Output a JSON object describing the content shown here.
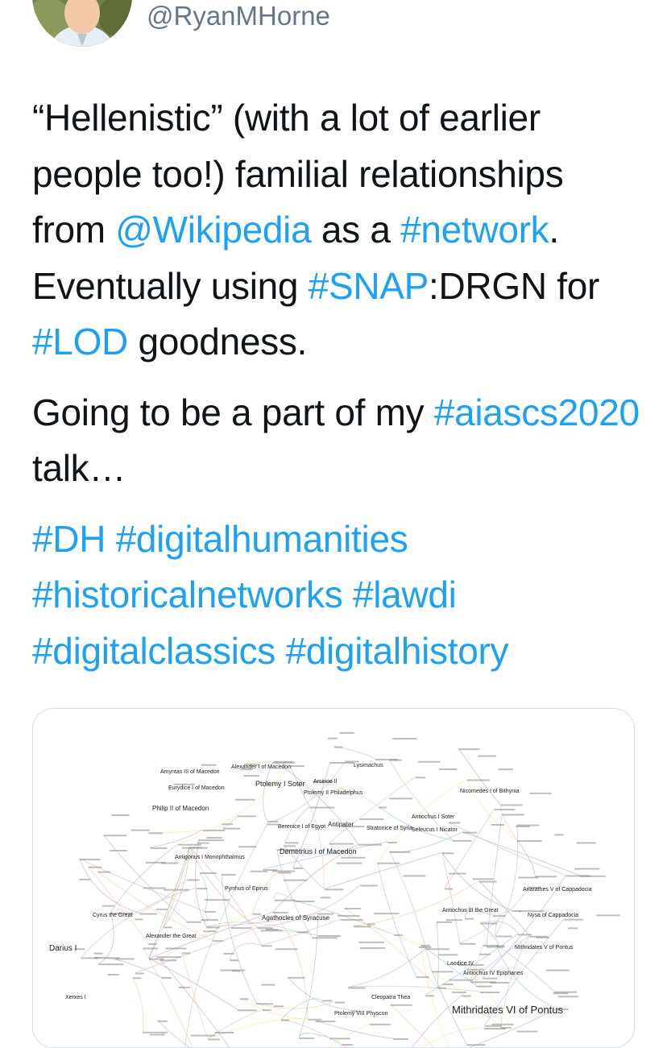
{
  "header": {
    "handle": "@RyanMHorne"
  },
  "tweet": {
    "paragraph1": [
      {
        "text": "“Hellenistic” (with a lot of earlier people too!) familial relationships from ",
        "link": false
      },
      {
        "text": "@Wikipedia",
        "link": true
      },
      {
        "text": " as a ",
        "link": false
      },
      {
        "text": "#network",
        "link": true
      },
      {
        "text": ". Eventually using ",
        "link": false
      },
      {
        "text": "#SNAP",
        "link": true
      },
      {
        "text": ":DRGN for ",
        "link": false
      },
      {
        "text": "#LOD",
        "link": true
      },
      {
        "text": " goodness.",
        "link": false
      }
    ],
    "paragraph2": [
      {
        "text": "Going to be a part of my ",
        "link": false
      },
      {
        "text": "#aiascs2020",
        "link": true
      },
      {
        "text": " talk…",
        "link": false
      }
    ],
    "hashtags": [
      "#DH",
      "#digitalhumanities",
      "#historicalnetworks",
      "#lawdi",
      "#digitalclassics",
      "#digitalhistory"
    ]
  },
  "network_image": {
    "labels": [
      "Amyntas III of Macedon",
      "Alexander I of Macedon",
      "Ptolemy I Soter",
      "Philip II of Macedon",
      "Lysimachus",
      "Arsinoe II",
      "Ptolemy II Philadelphus",
      "Berenice I of Egypt",
      "Antipater",
      "Stratonice of Syria",
      "Antiochus I Soter",
      "Seleucus I Nicator",
      "Nicomedes I of Bithynia",
      "Demetrius I of Macedon",
      "Eurydice I of Macedon",
      "Pyrrhus of Epirus",
      "Agathocles of Syracuse",
      "Antiochus III the Great",
      "Ariarathes V of Cappadocia",
      "Nysa of Cappadocia",
      "Cyrus the Great",
      "Alexander the Great",
      "Darius I",
      "Xerxes I",
      "Mithridates V of Pontus",
      "Mithridates VI of Pontus",
      "Ptolemy VIII Physcon",
      "Cleopatra Thea",
      "Laodice IV",
      "Antiochus IV Epiphanes",
      "Antigonus I Monophthalmus"
    ]
  },
  "colors": {
    "link": "#1da1f2",
    "text": "#0f1419",
    "secondary": "#657786",
    "border": "#d7dde2"
  }
}
